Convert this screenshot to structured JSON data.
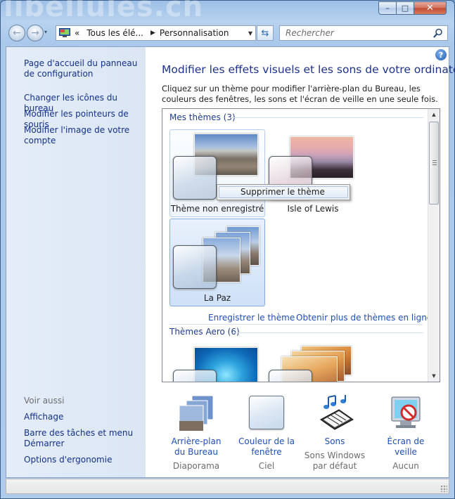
{
  "watermark": "libellules.ch",
  "titlebar": {
    "minimize_glyph": "–",
    "maximize_glyph": "□",
    "close_glyph": "✕"
  },
  "nav": {
    "back_glyph": "←",
    "forward_glyph": "→",
    "history_glyph": "▾",
    "address": {
      "overflow_glyph": "«",
      "segment1": "Tous les élé...",
      "arrow_glyph": "▶",
      "segment2": "Personnalisation",
      "dropdown_glyph": "▼"
    },
    "refresh_glyph": "⇆",
    "search_placeholder": "Rechercher"
  },
  "sidebar": {
    "links": [
      "Page d'accueil du panneau de configuration",
      "Changer les icônes du bureau",
      "Modifier les pointeurs de souris",
      "Modifier l'image de votre compte"
    ],
    "see_also_title": "Voir aussi",
    "see_also": [
      "Affichage",
      "Barre des tâches et menu Démarrer",
      "Options d'ergonomie"
    ]
  },
  "main": {
    "help_glyph": "?",
    "title": "Modifier les effets visuels et les sons de votre ordinateur",
    "description": "Cliquez sur un thème pour modifier l'arrière-plan du Bureau, les couleurs des fenêtres, les sons et l'écran de veille en une seule fois."
  },
  "themes": {
    "my_themes_group": "Mes thèmes (3)",
    "aero_group": "Thèmes Aero (6)",
    "items": [
      {
        "name": "Thème non enregistré"
      },
      {
        "name": "Isle of Lewis"
      },
      {
        "name": "La Paz"
      }
    ],
    "context_menu_item": "Supprimer le thème",
    "save_link": "Enregistrer le thème",
    "online_link": "Obtenir plus de thèmes en ligne",
    "scroll_up_glyph": "▲",
    "scroll_down_glyph": "▼"
  },
  "settings": {
    "background": {
      "label": "Arrière-plan du Bureau",
      "value": "Diaporama"
    },
    "color": {
      "label": "Couleur de la fenêtre",
      "value": "Ciel"
    },
    "sounds": {
      "label": "Sons",
      "value": "Sons Windows par défaut"
    },
    "screensaver": {
      "label": "Écran de veille",
      "value": "Aucun"
    }
  }
}
